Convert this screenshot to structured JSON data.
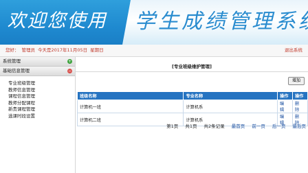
{
  "banner": {
    "welcome": "欢迎您使用",
    "system_title": "学生成绩管理系统"
  },
  "infobar": {
    "greeting": "您好：",
    "user": "管理员",
    "today": "今天是2017年11月05日",
    "weekday": "星期日",
    "logout": "退出系统"
  },
  "sidebar": {
    "groups": [
      {
        "label": "系统管理",
        "toggle": "+",
        "color": "#3ea33e"
      },
      {
        "label": "基础信息管理",
        "toggle": "−",
        "color": "#d9534f"
      }
    ],
    "items": [
      {
        "label": "专业班级管理"
      },
      {
        "label": "教师信息管理"
      },
      {
        "label": "课程信息管理"
      },
      {
        "label": "教师分配课程"
      },
      {
        "label": "新贵课程管理"
      },
      {
        "label": "选课时段设置"
      }
    ]
  },
  "main": {
    "title": "[专业班级维护管理]",
    "add_label": "增加",
    "table": {
      "headers": [
        "班级名称",
        "专业名称",
        "操作",
        "操作"
      ],
      "rows": [
        {
          "class_name": "计算机一班",
          "major": "计算机系",
          "edit": "编辑",
          "delete": "删除"
        },
        {
          "class_name": "计算机二班",
          "major": "计算机系",
          "edit": "编辑",
          "delete": "删除"
        }
      ]
    },
    "pager": {
      "page": "第1页",
      "total_pages": "共1页",
      "total_records": "共2条记录",
      "first": "最首页",
      "prev": "前一页",
      "next": "后一页",
      "last": "最后页"
    }
  },
  "colors": {
    "banner": "#1f8ad0",
    "table_header": "#2573c1",
    "link": "#1a4fa0",
    "alert_text": "#c0392b"
  }
}
